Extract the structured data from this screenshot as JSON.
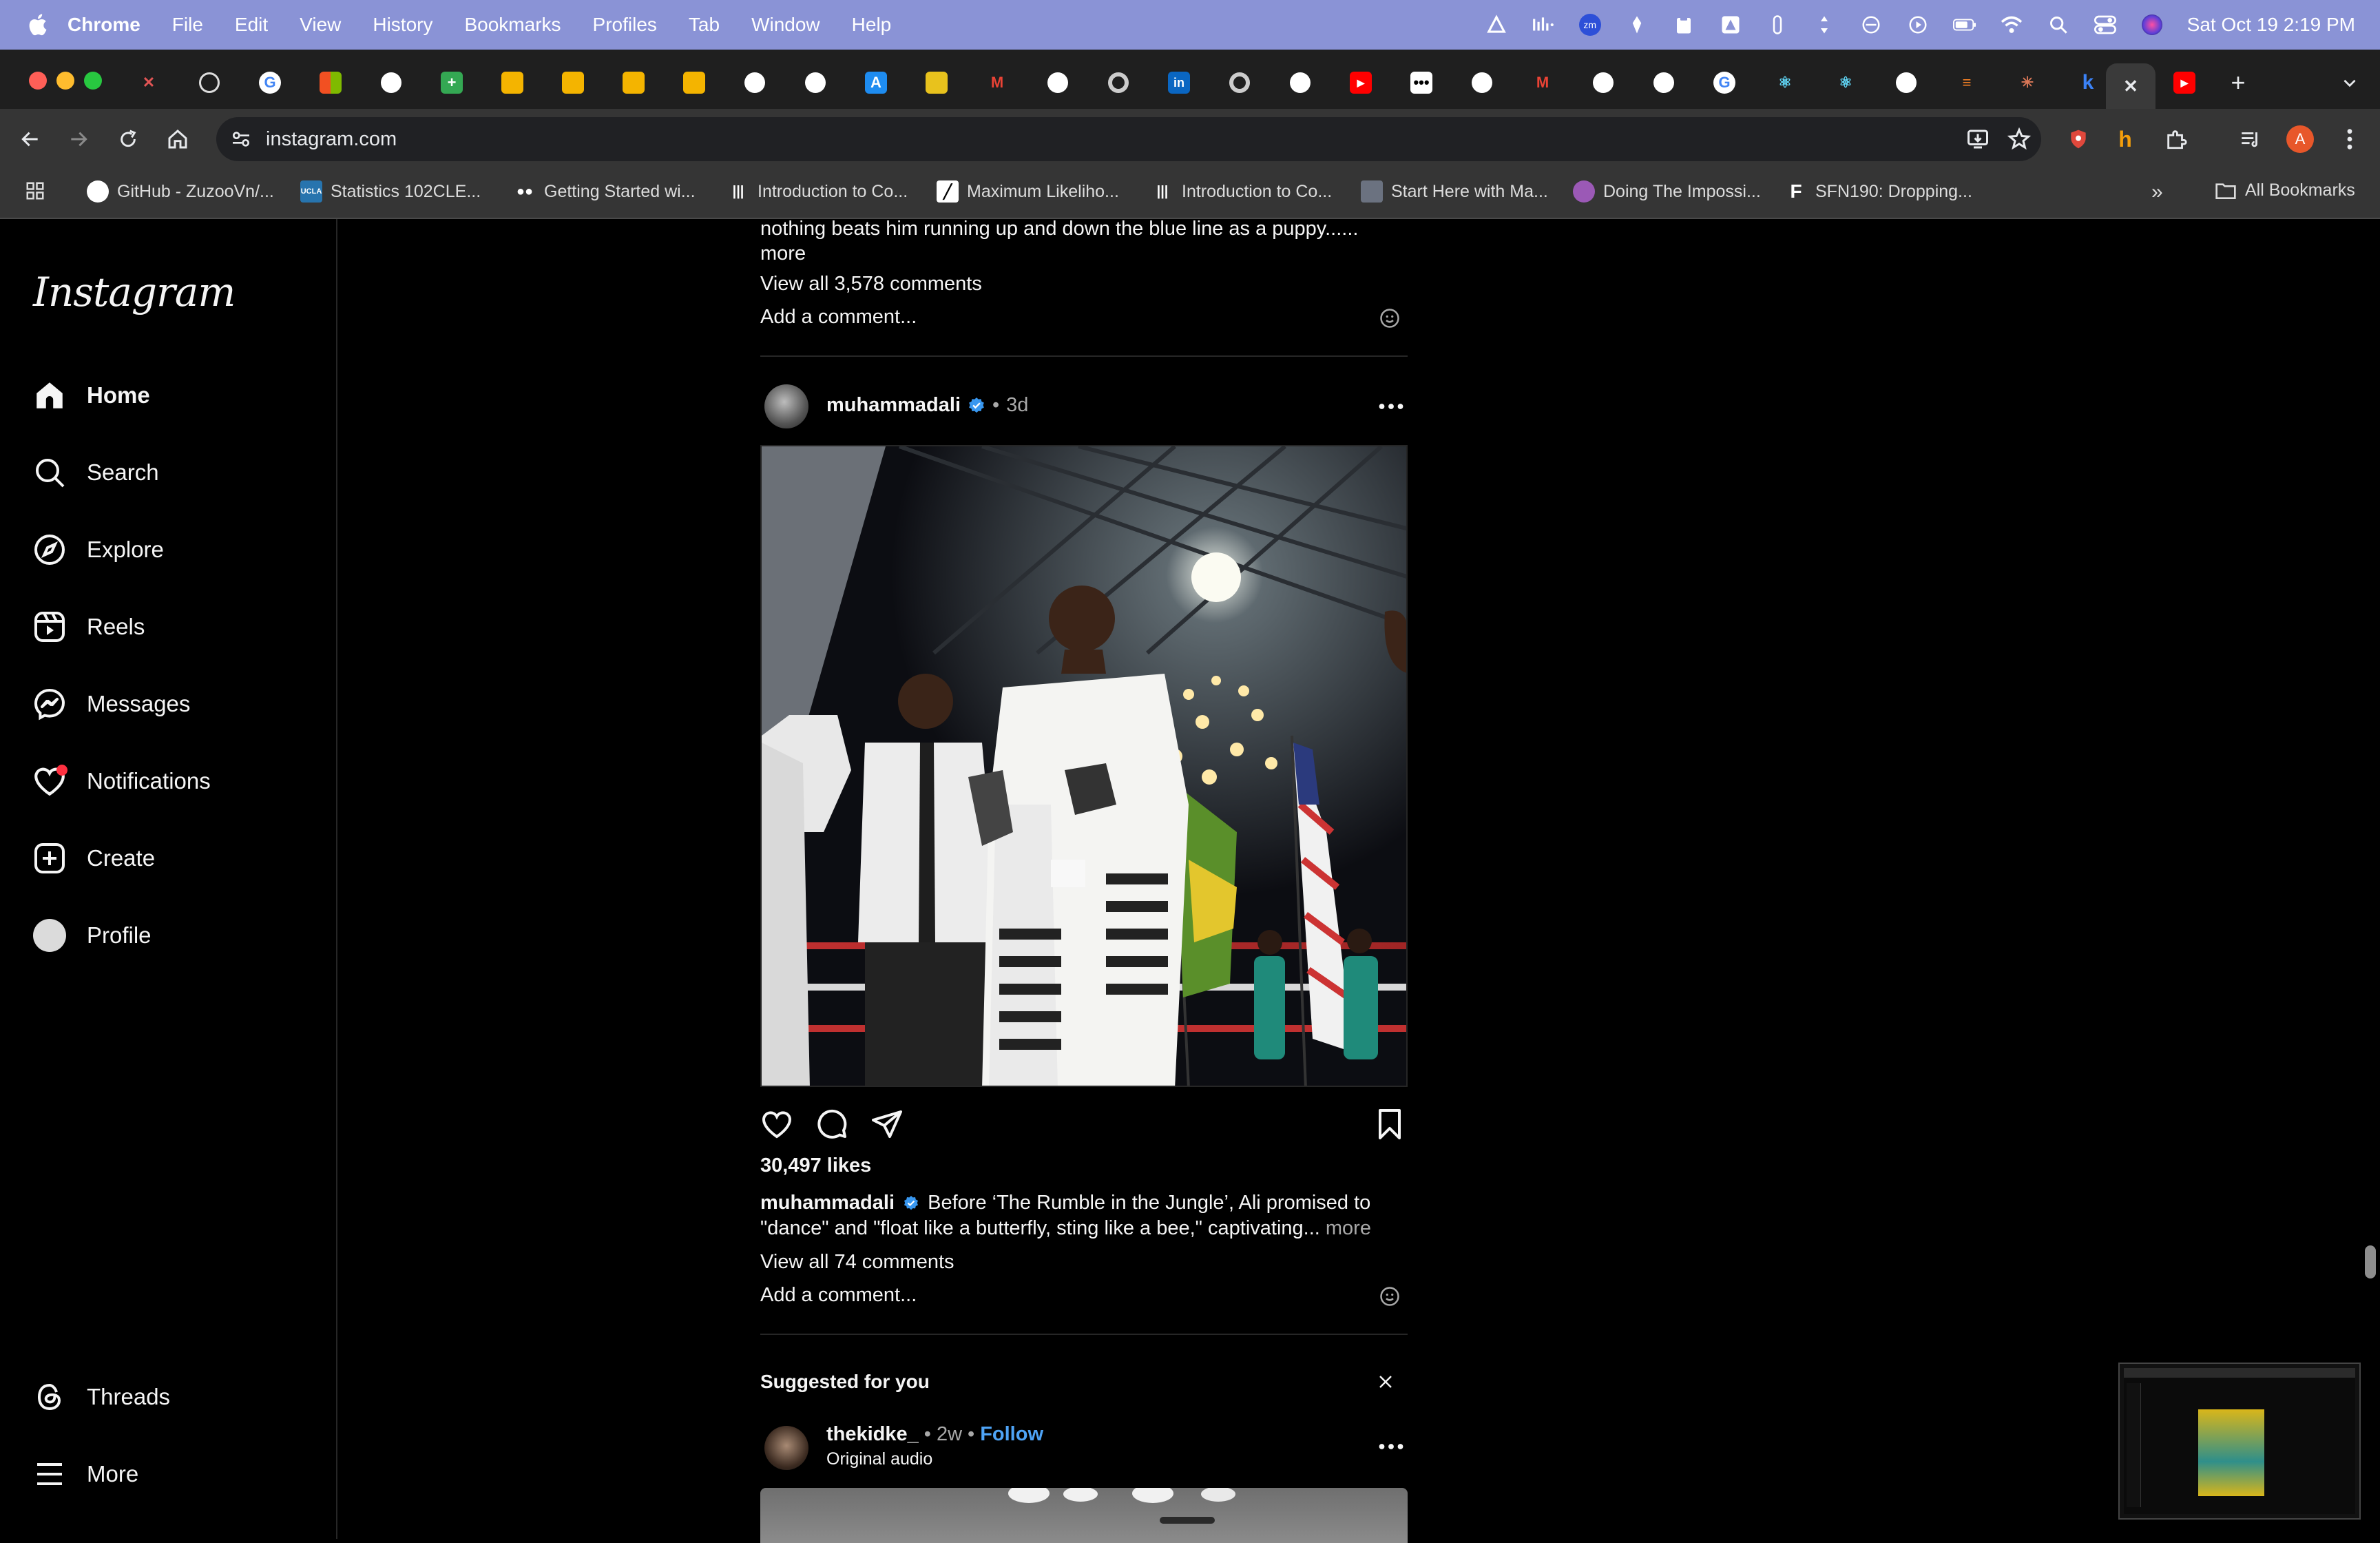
{
  "menubar": {
    "items": [
      "Chrome",
      "File",
      "Edit",
      "View",
      "History",
      "Bookmarks",
      "Profiles",
      "Tab",
      "Window",
      "Help"
    ],
    "datetime": "Sat Oct 19  2:19 PM",
    "zoom_badge": "zm"
  },
  "toolbar": {
    "url": "instagram.com",
    "profile_initial": "A"
  },
  "bookmarks": [
    {
      "label": "GitHub - ZuzooVn/...",
      "icon": "github-icon"
    },
    {
      "label": "Statistics 102CLE...",
      "icon": "ucla-icon",
      "icon_text": "UCLA"
    },
    {
      "label": "Getting Started wi...",
      "icon": "medium-icon"
    },
    {
      "label": "Introduction to Co...",
      "icon": "bars-icon"
    },
    {
      "label": "Maximum Likeliho...",
      "icon": "chart-icon"
    },
    {
      "label": "Introduction to Co...",
      "icon": "bars-icon"
    },
    {
      "label": "Start Here with Ma...",
      "icon": "site-icon"
    },
    {
      "label": "Doing The Impossi...",
      "icon": "globe-icon"
    },
    {
      "label": "SFN190: Dropping...",
      "icon": "f-icon",
      "icon_text": "F"
    }
  ],
  "bookmarks_all": "All Bookmarks",
  "instagram": {
    "logo": "Instagram",
    "nav": {
      "home": "Home",
      "search": "Search",
      "explore": "Explore",
      "reels": "Reels",
      "messages": "Messages",
      "notifications": "Notifications",
      "create": "Create",
      "profile": "Profile",
      "threads": "Threads",
      "more": "More"
    },
    "prev_post": {
      "caption_tail": "nothing beats him running up and down the blue line as a puppy......",
      "more": "more",
      "view_comments": "View all 3,578 comments",
      "add_comment": "Add a comment..."
    },
    "post": {
      "username": "muhammadali",
      "time": "3d",
      "likes": "30,497 likes",
      "caption_user": "muhammadali",
      "caption_text": "Before ‘The Rumble in the Jungle’, Ali promised to \"dance\" and \"float like a butterfly, sting like a bee,\" captivating...",
      "more": "more",
      "view_comments": "View all 74 comments",
      "add_comment": "Add a comment..."
    },
    "suggested": {
      "title": "Suggested for you",
      "username": "thekidke_",
      "time": "2w",
      "follow": "Follow",
      "subtitle": "Original audio"
    }
  },
  "colors": {
    "menubar": "#8a93d6",
    "accent_blue": "#0095f6",
    "verified": "#3897f0",
    "notification_dot": "#ff3040"
  }
}
